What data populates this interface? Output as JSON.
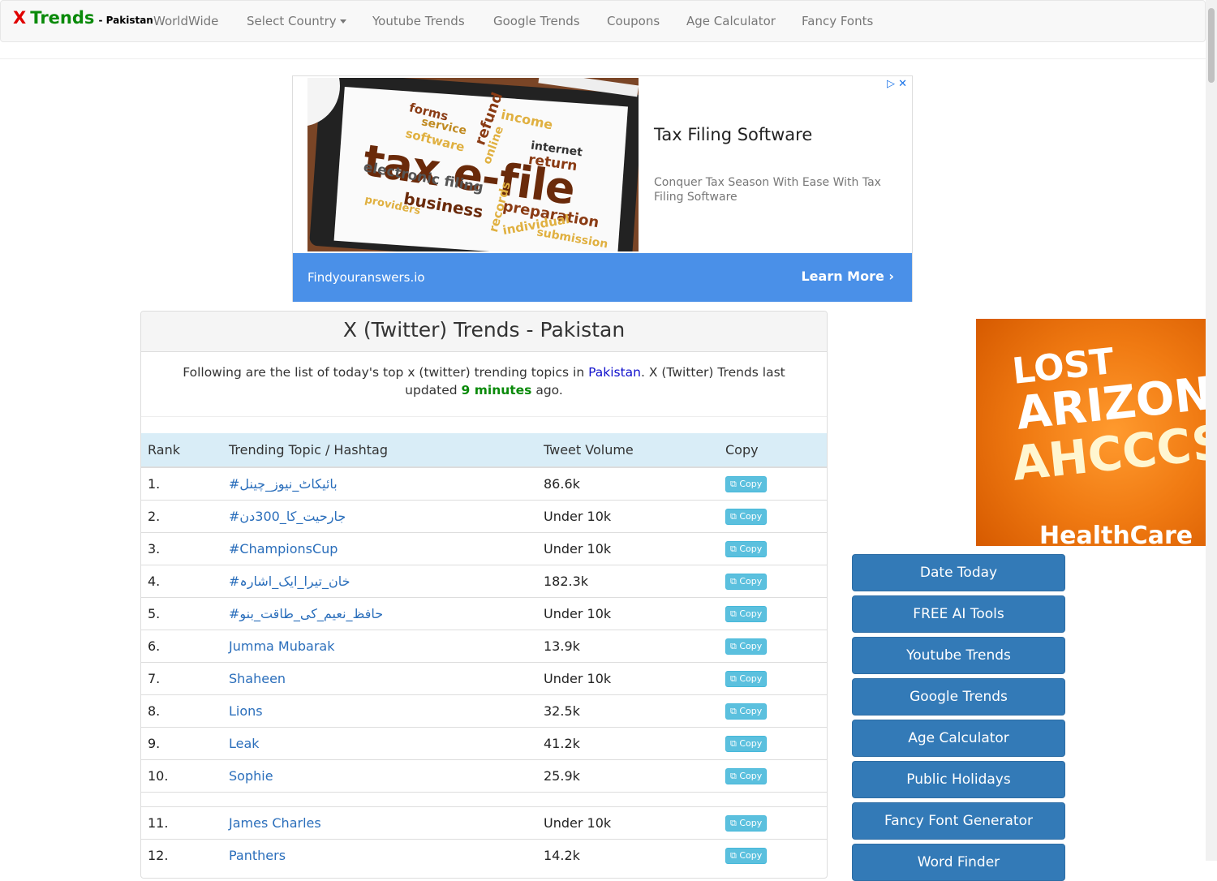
{
  "brand": {
    "x": "X",
    "trends": "Trends",
    "country": "- Pakistan"
  },
  "nav": [
    "WorldWide",
    "Select Country",
    "Youtube Trends",
    "Google Trends",
    "Coupons",
    "Age Calculator",
    "Fancy Fonts"
  ],
  "ad_top": {
    "image_words": [
      "forms",
      "service",
      "refund",
      "income",
      "software",
      "online",
      "internet",
      "return",
      "tax e-file",
      "electronic filing",
      "business",
      "records",
      "preparation",
      "individual",
      "providers",
      "submission"
    ],
    "headline": "Tax Filing Software",
    "description": "Conquer Tax Season With Ease With Tax Filing Software",
    "domain": "Findyouranswers.io",
    "cta": "Learn More"
  },
  "panel": {
    "title": "X (Twitter) Trends - Pakistan",
    "intro_before": "Following are the list of today's top x (twitter) trending topics in ",
    "country": "Pakistan",
    "intro_middle": ". X (Twitter) Trends last updated ",
    "updated": "9 minutes",
    "intro_after": " ago."
  },
  "table": {
    "headers": [
      "Rank",
      "Trending Topic / Hashtag",
      "Tweet Volume",
      "Copy"
    ],
    "copy_label": "Copy",
    "rows": [
      {
        "rank": "1.",
        "topic": "#بائیکاٹ_نیوز_چینل",
        "volume": "86.6k"
      },
      {
        "rank": "2.",
        "topic": "#جارحیت_کا_300دن",
        "volume": "Under 10k"
      },
      {
        "rank": "3.",
        "topic": "#ChampionsCup",
        "volume": "Under 10k"
      },
      {
        "rank": "4.",
        "topic": "#خان_تیرا_ایک_اشارہ",
        "volume": "182.3k"
      },
      {
        "rank": "5.",
        "topic": "#حافظ_نعیم_کی_طاقت_بنو",
        "volume": "Under 10k"
      },
      {
        "rank": "6.",
        "topic": "Jumma Mubarak",
        "volume": "13.9k"
      },
      {
        "rank": "7.",
        "topic": "Shaheen",
        "volume": "Under 10k"
      },
      {
        "rank": "8.",
        "topic": "Lions",
        "volume": "32.5k"
      },
      {
        "rank": "9.",
        "topic": "Leak",
        "volume": "41.2k"
      },
      {
        "rank": "10.",
        "topic": "Sophie",
        "volume": "25.9k"
      }
    ],
    "rows2": [
      {
        "rank": "11.",
        "topic": "James Charles",
        "volume": "Under 10k"
      },
      {
        "rank": "12.",
        "topic": "Panthers",
        "volume": "14.2k"
      }
    ]
  },
  "ad_right": {
    "line1": "LOST",
    "line2": "ARIZONA",
    "line3": "AHCCCS",
    "line4": "HealthCare"
  },
  "side_buttons": [
    "Date Today",
    "FREE AI Tools",
    "Youtube Trends",
    "Google Trends",
    "Age Calculator",
    "Public Holidays",
    "Fancy Font Generator",
    "Word Finder"
  ],
  "colors": {
    "brand_red": "#e00000",
    "brand_green": "#0a8a0a",
    "button_blue": "#337ab7",
    "copy_btn": "#5bc0de",
    "table_header": "#d9edf7",
    "ad_bar": "#4a90e8"
  }
}
